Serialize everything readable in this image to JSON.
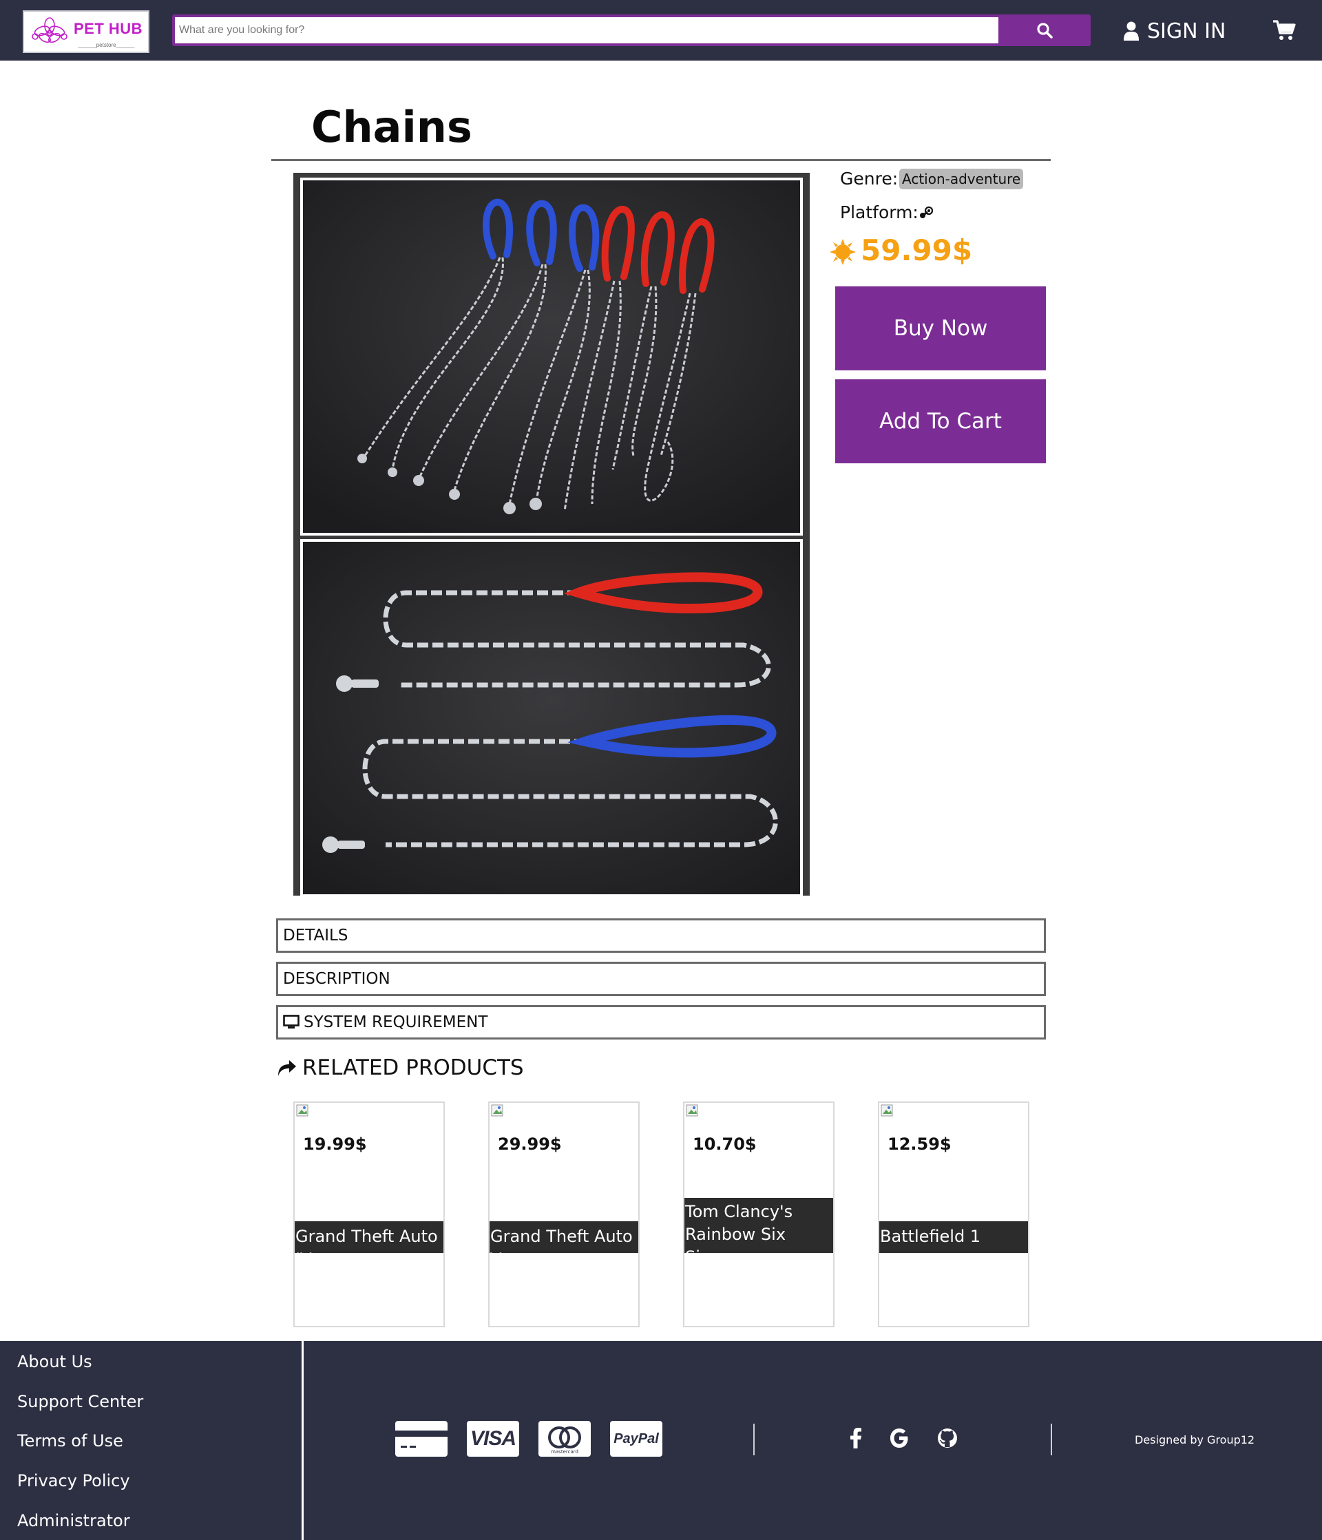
{
  "header": {
    "logo_text": "PET HUB",
    "logo_sub": "______petstore______",
    "search_placeholder": "What are you looking for?",
    "signin_label": "SIGN IN"
  },
  "product": {
    "title": "Chains",
    "genre_label": "Genre:",
    "genre_value": "Action-adventure",
    "platform_label": "Platform:",
    "price": "59.99$",
    "buy_label": "Buy Now",
    "cart_label": "Add To Cart",
    "image_alt_1": "Dog leash chains with red and blue handles",
    "image_alt_2": "Two chain leashes with red and blue handles"
  },
  "sections": {
    "details": "DETAILS",
    "description": "DESCRIPTION",
    "system": "SYSTEM REQUIREMENT",
    "related": "RELATED PRODUCTS"
  },
  "related_products": [
    {
      "price": "19.99$",
      "name": "Grand Theft Auto IV"
    },
    {
      "price": "29.99$",
      "name": "Grand Theft Auto V"
    },
    {
      "price": "10.70$",
      "name": "Tom Clancy's Rainbow Six Siege"
    },
    {
      "price": "12.59$",
      "name": "Battlefield 1"
    }
  ],
  "footer": {
    "links": [
      "About Us",
      "Support Center",
      "Terms of Use",
      "Privacy Policy",
      "Administrator"
    ],
    "payments": [
      "credit-card",
      "VISA",
      "mastercard",
      "PayPal"
    ],
    "mastercard_text": "mastercard",
    "visa_text": "VISA",
    "paypal_text": "PayPal",
    "social": [
      "facebook",
      "google",
      "github"
    ],
    "credit": "Designed by Group12"
  },
  "colors": {
    "header_bg": "#2d2f43",
    "accent_purple": "#7b2d95",
    "price_orange": "#f6a013",
    "logo_pink": "#c21fc8"
  }
}
